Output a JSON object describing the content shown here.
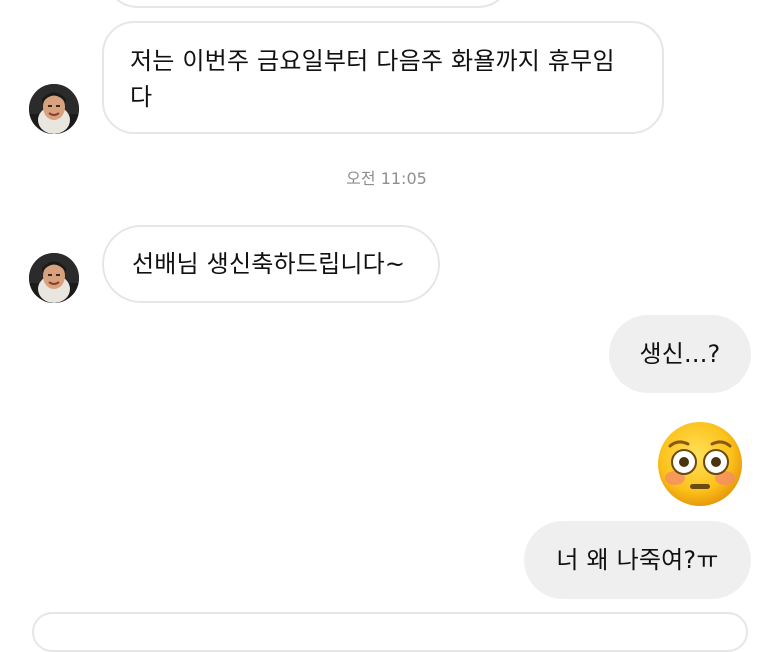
{
  "messages": {
    "m1_line1": "저는 이번주 금요일부터 다음주 화욜까지 휴무임",
    "m1_line2": "다",
    "timestamp": "오전 11:05",
    "m2": "선배님 생신축하드립니다~",
    "m3": "생신...?",
    "m4_emoji": "flushed-face-emoji",
    "m5": "너 왜 나죽여?ㅠ"
  },
  "colors": {
    "incoming_bubble_bg": "#ffffff",
    "incoming_bubble_border": "#e6e6e6",
    "outgoing_bubble_bg": "#efefef",
    "timestamp_text": "#8e8e8e",
    "message_text": "#111111"
  },
  "icons": {
    "avatar": "profile-photo-avatar",
    "emoji": "flushed-face-emoji"
  }
}
